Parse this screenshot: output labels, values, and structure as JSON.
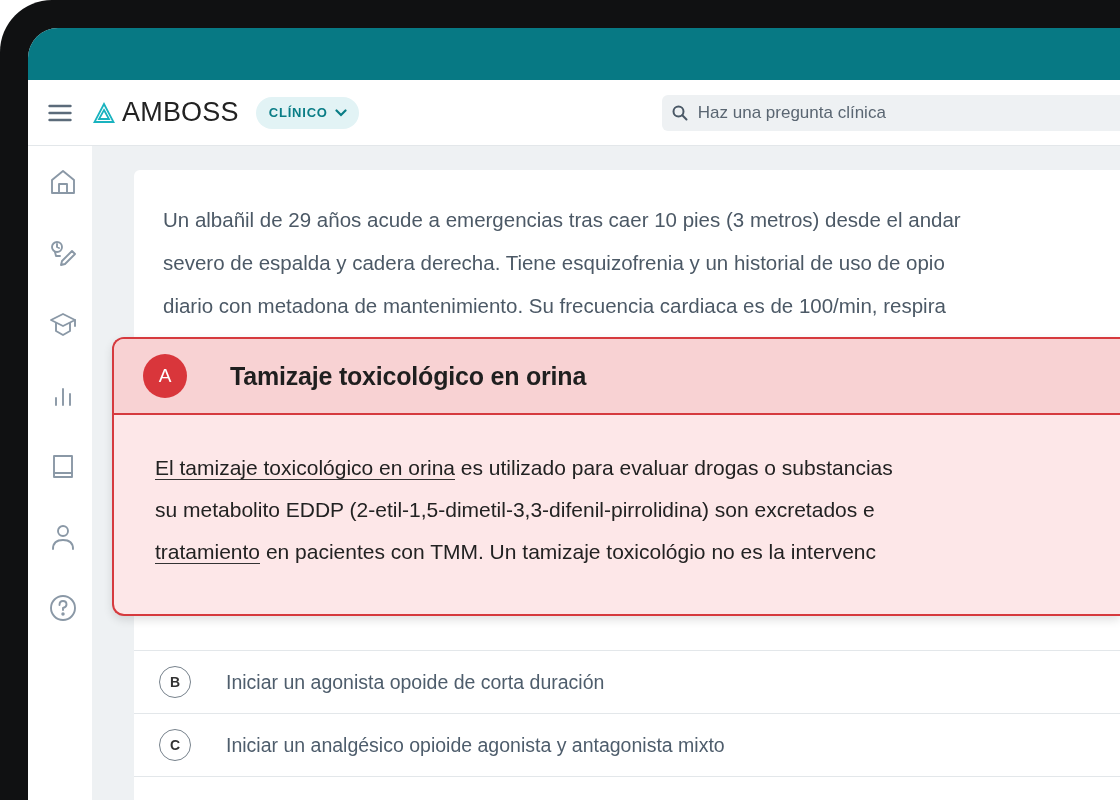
{
  "header": {
    "brand": "AMBOSS",
    "mode_chip": "CLÍNICO",
    "search": {
      "placeholder": "Haz una pregunta clínica"
    }
  },
  "question": {
    "lines": [
      "Un albañil de 29 años acude a emergencias tras caer 10 pies (3 metros) desde el andar",
      "severo de espalda y cadera derecha.  Tiene esquizofrenia  y un historial de uso de opio",
      "diario con metadona de mantenimiento. Su frecuencia cardiaca es de 100/min, respira"
    ]
  },
  "options": [
    {
      "letter": "A",
      "text": "Tamizaje toxicológico en orina",
      "selected": true,
      "explanation": [
        [
          {
            "text": "El tamizaje toxicológico en orina",
            "link": true
          },
          {
            "text": " es utilizado para evaluar drogas o substancias",
            "link": false
          }
        ],
        [
          {
            "text": "su metabolito EDDP (2-etil-1,5-dimetil-3,3-difenil-pirrolidina) son excretados e",
            "link": false
          }
        ],
        [
          {
            "text": "tratamiento",
            "link": true
          },
          {
            "text": " en pacientes con TMM. Un tamizaje toxicológio no es la intervenc",
            "link": false
          }
        ]
      ]
    },
    {
      "letter": "B",
      "text": "Iniciar un agonista opoide de corta duración",
      "selected": false
    },
    {
      "letter": "C",
      "text": "Iniciar un analgésico opioide agonista y antagonista mixto",
      "selected": false
    }
  ]
}
